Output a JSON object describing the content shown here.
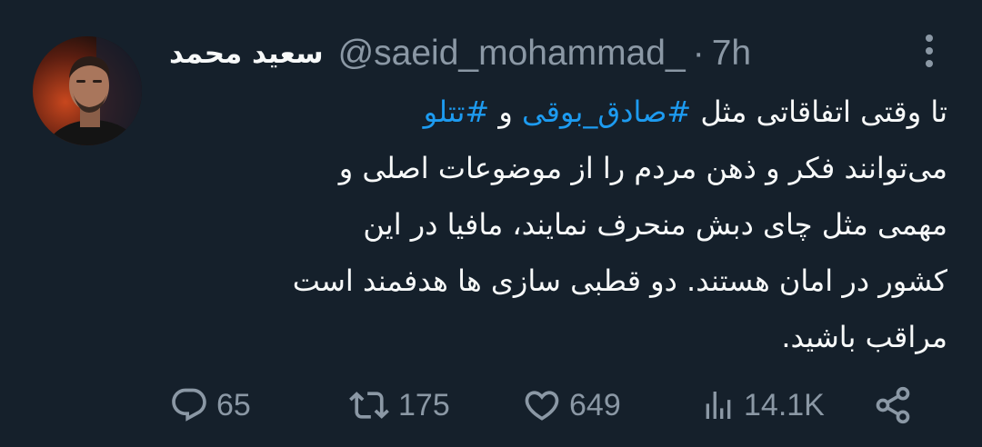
{
  "tweet": {
    "author": {
      "display_name": "سعید محمد",
      "handle": "@saeid_mohammad_",
      "time": "7h",
      "separator": "·"
    },
    "lines": [
      {
        "segments": [
          {
            "text": "تا وقتی اتفاقاتی مثل ",
            "hashtag": false
          },
          {
            "text": "#صادق_بوقی",
            "hashtag": true
          },
          {
            "text": " و ",
            "hashtag": false
          },
          {
            "text": "#تتلو",
            "hashtag": true
          }
        ]
      },
      {
        "segments": [
          {
            "text": "می‌توانند فکر و ذهن مردم را از موضوعات اصلی و",
            "hashtag": false
          }
        ]
      },
      {
        "segments": [
          {
            "text": "مهمی مثل چای دبش منحرف نمایند، مافیا در این",
            "hashtag": false
          }
        ]
      },
      {
        "segments": [
          {
            "text": "کشور در امان هستند. دو قطبی  سازی ها هدفمند است",
            "hashtag": false
          }
        ]
      },
      {
        "segments": [
          {
            "text": "مراقب باشید.",
            "hashtag": false
          }
        ]
      }
    ]
  },
  "actions": {
    "reply": {
      "icon": "reply-icon",
      "count": "65"
    },
    "retweet": {
      "icon": "retweet-icon",
      "count": "175"
    },
    "like": {
      "icon": "heart-icon",
      "count": "649"
    },
    "views": {
      "icon": "views-icon",
      "count": "14.1K"
    },
    "share": {
      "icon": "share-icon"
    }
  },
  "colors": {
    "background": "#15202b",
    "text": "#f7f9f9",
    "muted": "#8b98a5",
    "accent": "#1d9bf0"
  }
}
